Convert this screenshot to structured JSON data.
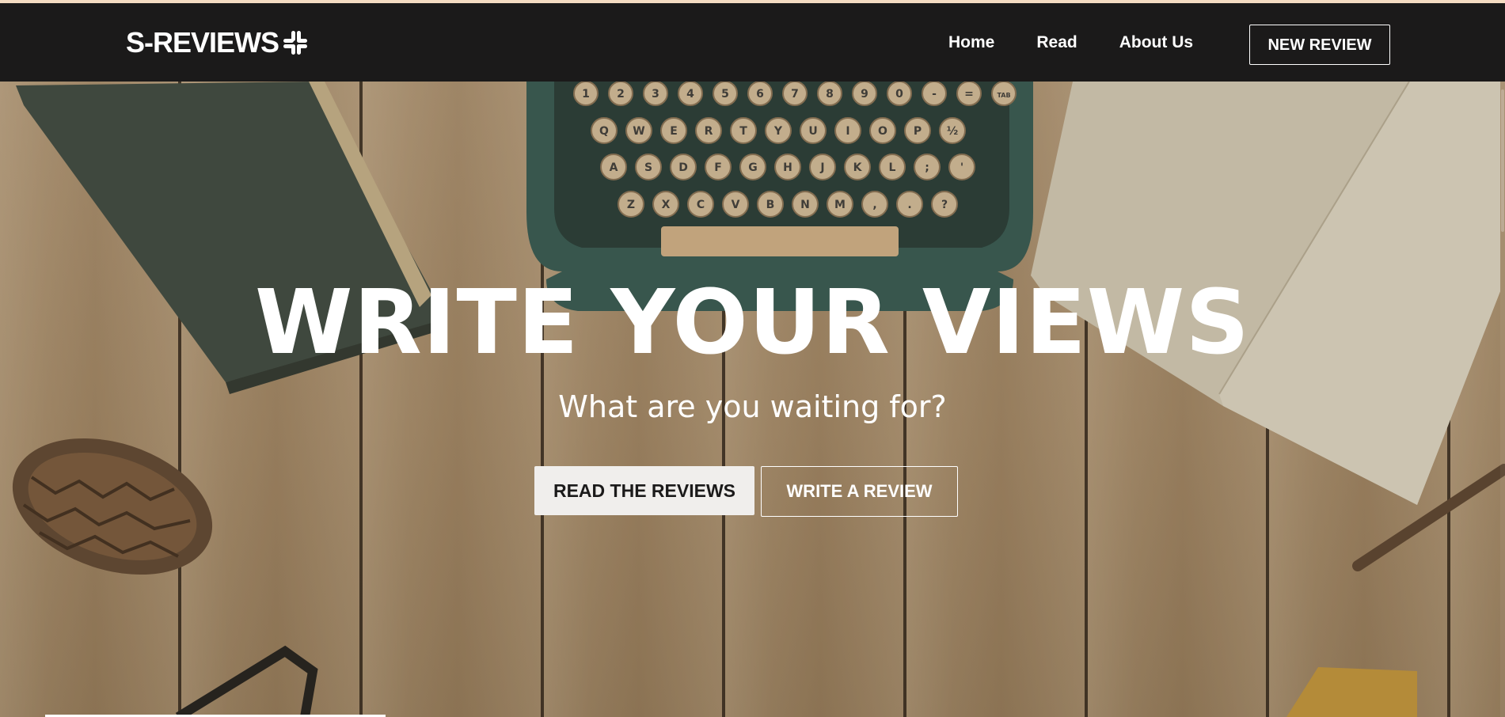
{
  "brand": {
    "name": "S-REVIEWS",
    "icon": "slack-hash-icon"
  },
  "nav": {
    "links": [
      "Home",
      "Read",
      "About Us"
    ],
    "cta": "NEW REVIEW"
  },
  "hero": {
    "title": "WRITE YOUR VIEWS",
    "subtitle": "What are you waiting for?",
    "primary_button": "READ THE REVIEWS",
    "secondary_button": "WRITE A REVIEW"
  },
  "typewriter_keys": {
    "row1": [
      "1",
      "2",
      "3",
      "4",
      "5",
      "6",
      "7",
      "8",
      "9",
      "0",
      "-",
      "=",
      "TAB"
    ],
    "row2": [
      "Q",
      "W",
      "E",
      "R",
      "T",
      "Y",
      "U",
      "I",
      "O",
      "P",
      "½"
    ],
    "row3": [
      "A",
      "S",
      "D",
      "F",
      "G",
      "H",
      "J",
      "K",
      "L",
      ";",
      "'"
    ],
    "row4": [
      "Z",
      "X",
      "C",
      "V",
      "B",
      "N",
      "M",
      ",",
      ".",
      "?"
    ]
  },
  "colors": {
    "navbar": "#1b1a1a",
    "accent_strip": "#f4dcc2",
    "text_light": "#ffffff"
  }
}
